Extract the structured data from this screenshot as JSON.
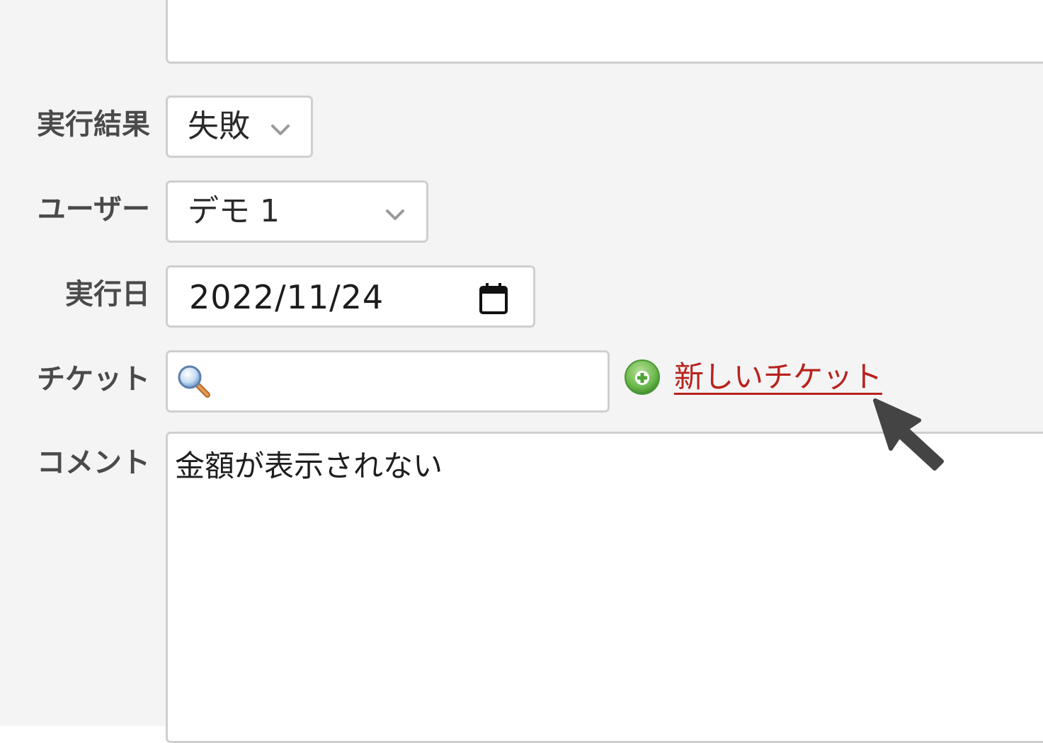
{
  "form": {
    "result": {
      "label": "実行結果",
      "value": "失敗"
    },
    "user": {
      "label": "ユーザー",
      "value": "デモ 1"
    },
    "date": {
      "label": "実行日",
      "value": "2022/11/24"
    },
    "ticket": {
      "label": "チケット",
      "value": "",
      "new_ticket_link": "新しいチケット"
    },
    "comment": {
      "label": "コメント",
      "value": "金額が表示されない"
    }
  },
  "icons": {
    "search": "search-icon",
    "add": "plus-circle-icon",
    "calendar": "calendar-icon",
    "dropdown": "chevron-down-icon",
    "cursor": "mouse-pointer-icon"
  },
  "colors": {
    "background": "#f4f4f4",
    "field_background": "#ffffff",
    "field_border": "#cfcfcf",
    "label": "#4a4a4a",
    "link": "#b8221d",
    "add_icon": "#5fb347"
  }
}
